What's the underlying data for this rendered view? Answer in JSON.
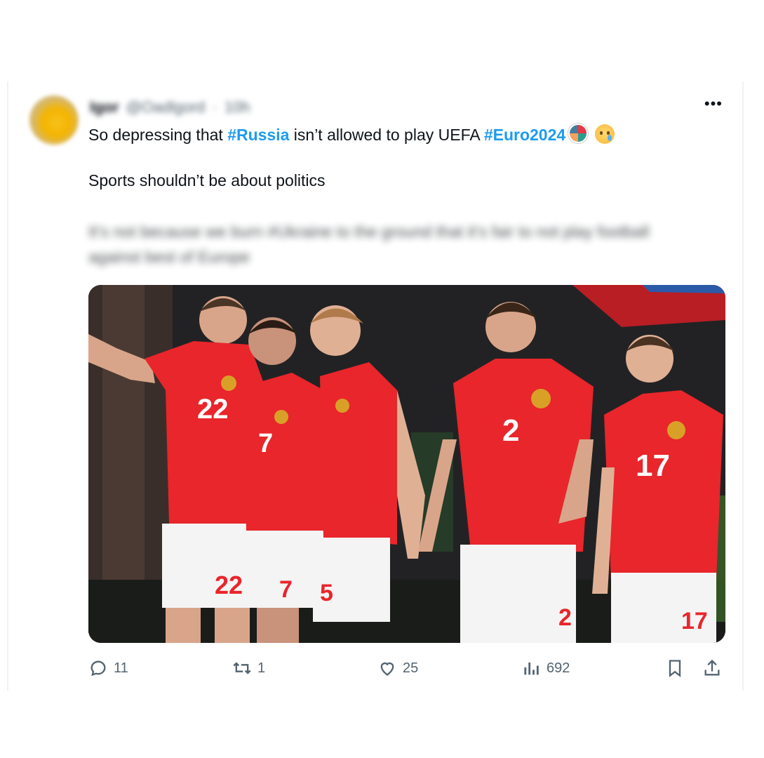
{
  "tweet": {
    "author_name": "Igor",
    "author_handle": "@Oadlgord",
    "time": "10h",
    "more_label": "•••",
    "text_prefix": "So depressing that ",
    "hashtag1": "#Russia",
    "text_middle": " isn’t allowed to play UEFA ",
    "hashtag2": "#Euro2024",
    "line2": "Sports shouldn’t be about politics",
    "blurred_text": "It’s not because we burn #Ukraine to the ground that it’s fair to not play football against best of Europe",
    "media_alt": "Russian national football team players in red kits celebrating",
    "players": [
      {
        "number": "22"
      },
      {
        "number": "7"
      },
      {
        "number": "5"
      },
      {
        "number": "2"
      },
      {
        "number": "17"
      }
    ]
  },
  "actions": {
    "reply_count": "11",
    "retweet_count": "1",
    "like_count": "25",
    "views_count": "692"
  },
  "icons": [
    "reply-icon",
    "retweet-icon",
    "like-icon",
    "views-icon",
    "bookmark-icon",
    "share-icon"
  ],
  "colors": {
    "hashtag": "#1d9bf0",
    "secondary_text": "#536471",
    "kit_red": "#e8262b",
    "shorts_white": "#f4f4f4"
  }
}
